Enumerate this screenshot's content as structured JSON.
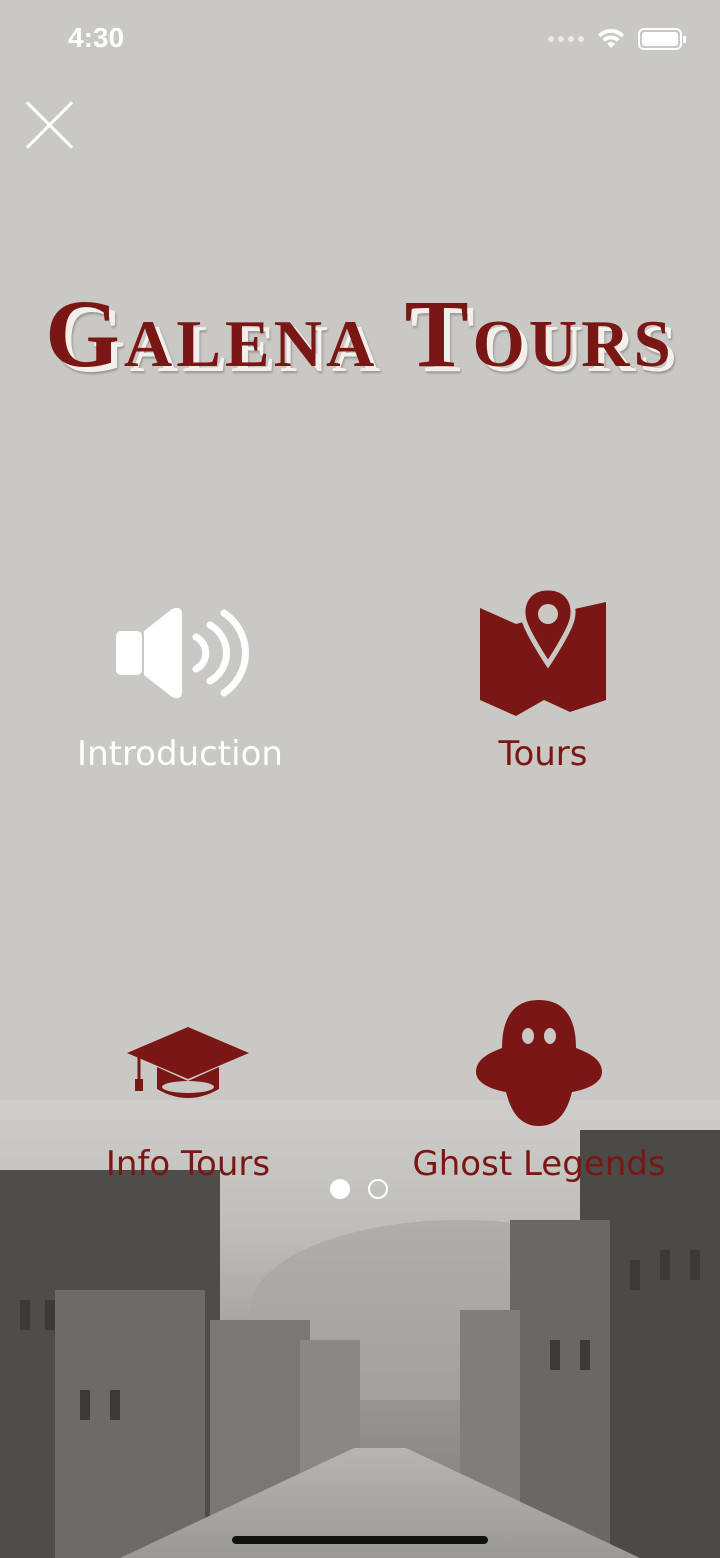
{
  "status_bar": {
    "time": "4:30"
  },
  "title": "Galena Tours",
  "menu": [
    {
      "label": "Introduction",
      "icon": "speaker-icon"
    },
    {
      "label": "Tours",
      "icon": "map-pin-icon"
    },
    {
      "label": "Info Tours",
      "icon": "graduation-cap-icon"
    },
    {
      "label": "Ghost Legends",
      "icon": "ghost-icon"
    }
  ],
  "pager": {
    "pages": 2,
    "current": 1
  },
  "colors": {
    "accent": "#7a1714",
    "background": "#c9c8c5",
    "white": "#ffffff"
  }
}
